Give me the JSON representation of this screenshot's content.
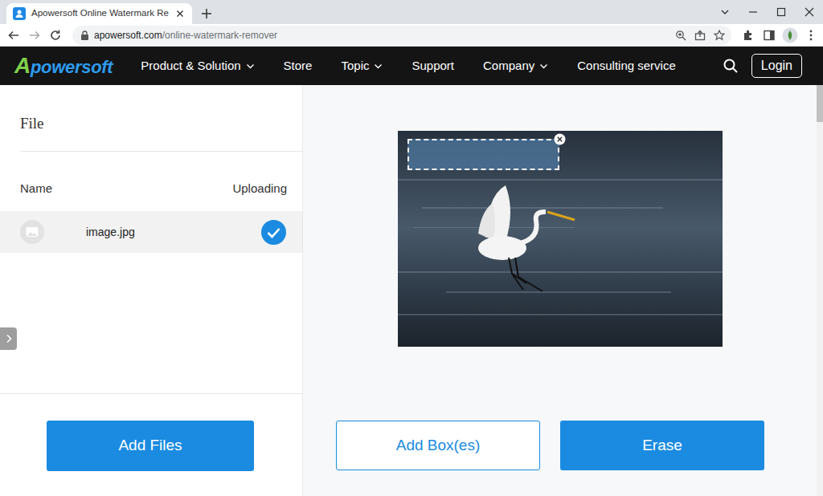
{
  "browser": {
    "tab": {
      "title": "Apowersoft Online Watermark Re",
      "selected": true
    },
    "url": {
      "host": "apowersoft.com",
      "path": "/online-watermark-remover"
    }
  },
  "site_nav": {
    "logo": "Apowersoft",
    "items": [
      {
        "label": "Product & Solution",
        "has_menu": true
      },
      {
        "label": "Store",
        "has_menu": false
      },
      {
        "label": "Topic",
        "has_menu": true
      },
      {
        "label": "Support",
        "has_menu": false
      },
      {
        "label": "Company",
        "has_menu": true
      },
      {
        "label": "Consulting service",
        "has_menu": false
      }
    ],
    "login": "Login"
  },
  "file_panel": {
    "title": "File",
    "columns": [
      "Name",
      "Uploading"
    ],
    "files": [
      {
        "name": "image.jpg",
        "uploaded": true,
        "selected": true
      }
    ],
    "add_button": "Add Files"
  },
  "editor": {
    "boxes": [
      {
        "selected": true
      }
    ],
    "buttons": [
      "Add Box(es)",
      "Erase"
    ]
  }
}
